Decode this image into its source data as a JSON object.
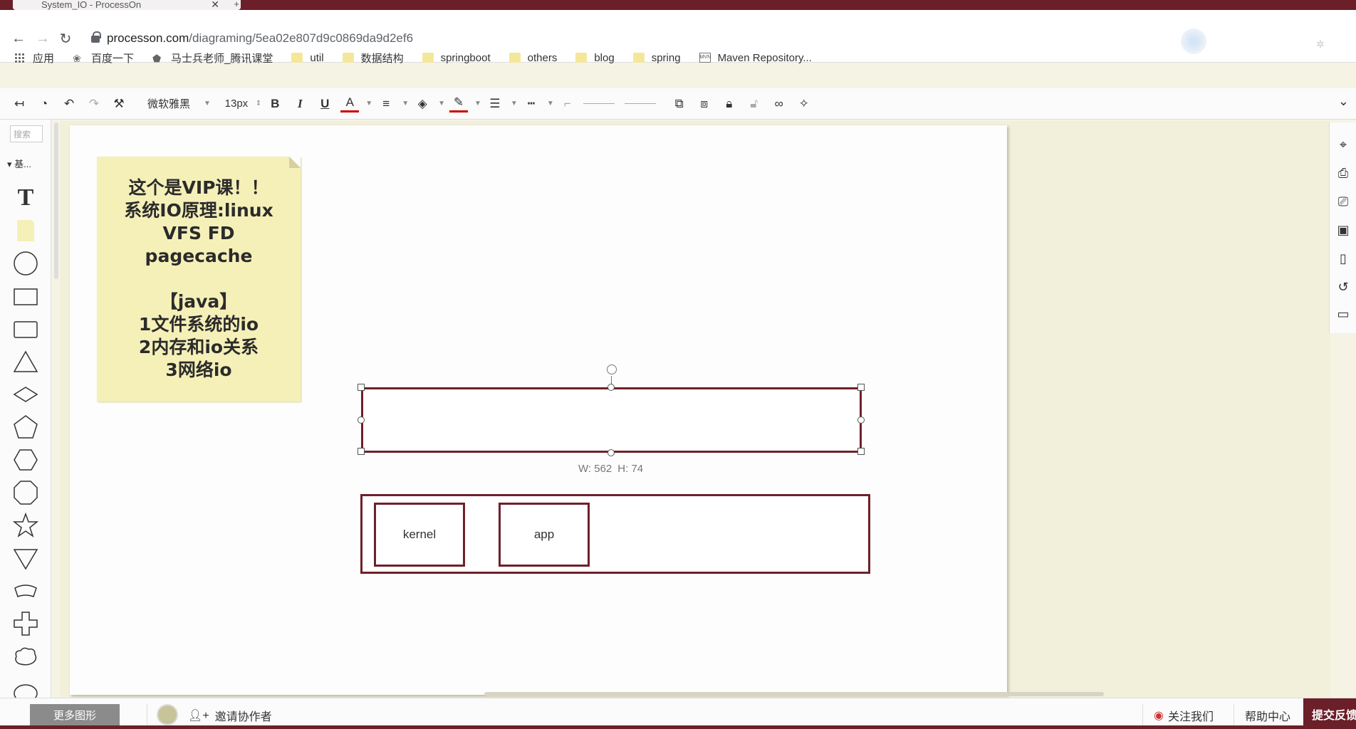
{
  "browser": {
    "tab_title": "System_IO - ProcessOn",
    "window_title": "",
    "url_host": "processon.com",
    "url_path": "/diagraming/5ea02e807d9c0869da9d2ef6"
  },
  "bookmarks": [
    {
      "label": "应用",
      "icon": "apps-grid-icon"
    },
    {
      "label": "百度一下",
      "icon": "baidu-paw-icon"
    },
    {
      "label": "马士兵老师_腾讯课堂",
      "icon": "tencent-class-icon"
    },
    {
      "label": "util",
      "icon": "folder-icon"
    },
    {
      "label": "数据结构",
      "icon": "folder-icon"
    },
    {
      "label": "springboot",
      "icon": "folder-icon"
    },
    {
      "label": "others",
      "icon": "folder-icon"
    },
    {
      "label": "blog",
      "icon": "folder-icon"
    },
    {
      "label": "spring",
      "icon": "folder-icon"
    },
    {
      "label": "Maven Repository...",
      "icon": "maven-icon"
    }
  ],
  "toolbar": {
    "font_family": "微软雅黑",
    "font_size": "13px"
  },
  "palette": {
    "search_placeholder": "搜索",
    "category_label": "基..."
  },
  "canvas": {
    "note_text": "这个是VIP课！！\n系统IO原理:linux\nVFS FD\npagecache\n\n【java】\n1文件系统的io\n2内存和io关系\n3网络io",
    "selection_dims": {
      "w_label": "W: 562",
      "h_label": "H: 74"
    },
    "boxes": [
      {
        "label": "kernel"
      },
      {
        "label": "app"
      }
    ],
    "accent_color": "#6f2029"
  },
  "bottombar": {
    "more_shapes": "更多图形",
    "invite": "邀请协作者",
    "follow": "关注我们",
    "help": "帮助中心",
    "feedback": "提交反馈"
  }
}
